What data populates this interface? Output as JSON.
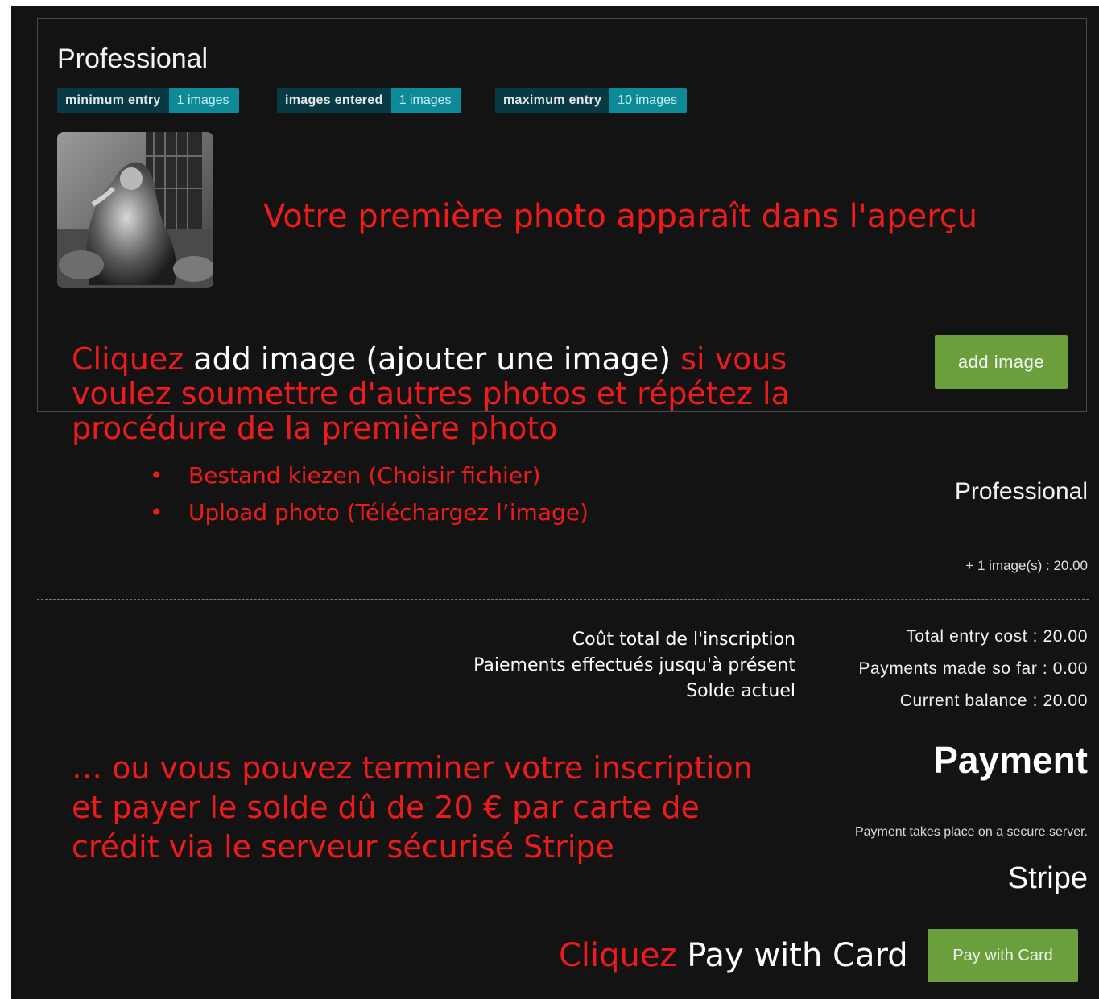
{
  "panel": {
    "title": "Professional",
    "badges": [
      {
        "label": "minimum entry",
        "value": "1 images"
      },
      {
        "label": "images entered",
        "value": "1 images"
      },
      {
        "label": "maximum entry",
        "value": "10 images"
      }
    ],
    "add_button": "add image"
  },
  "annotations": {
    "preview_note": "Votre première photo apparaît dans l'aperçu",
    "add_note_cliquez": "Cliquez",
    "add_note_label": "add image (ajouter une image)",
    "add_note_rest1": "si vous",
    "add_note_line2": "voulez soumettre d'autres photos et répétez la",
    "add_note_line3": "procédure de la première photo",
    "bullet_1": "Bestand kiezen (Choisir fichier)",
    "bullet_2": "Upload photo (Téléchargez l’image)",
    "fr_total": "Coût total de l'inscription",
    "fr_payments": "Paiements effectués jusqu'à présent",
    "fr_balance": "Solde actuel",
    "pay_note_line1": "… ou vous pouvez terminer votre inscription",
    "pay_note_line2": "et payer le solde dû de 20 € par carte de",
    "pay_note_line3": "crédit via le serveur sécurisé Stripe",
    "pay_cliquez": "Cliquez",
    "pay_label": "Pay with Card"
  },
  "summary": {
    "category": "Professional",
    "images_line": "+ 1 image(s) : 20.00",
    "total_entry_cost": "Total entry cost : 20.00",
    "payments_made": "Payments made so far : 0.00",
    "current_balance": "Current balance : 20.00"
  },
  "payment": {
    "heading": "Payment",
    "secure_note": "Payment takes place on a secure server.",
    "provider": "Stripe",
    "pay_button": "Pay with Card"
  },
  "colors": {
    "background": "#131313",
    "annotation_red": "#ee1b1b",
    "button_green": "#6a9f3b",
    "badge_dark": "#083a46",
    "badge_teal": "#0c8a97"
  }
}
